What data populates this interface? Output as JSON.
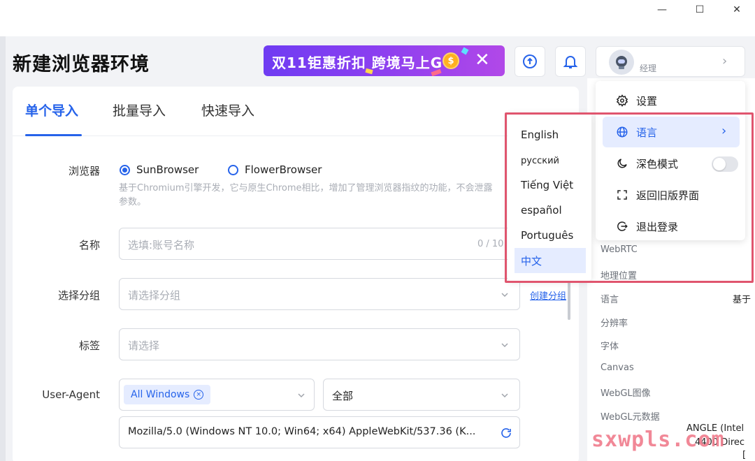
{
  "window": {
    "minimize": "—",
    "maximize": "☐",
    "close": "✕"
  },
  "app_title": "新建浏览器环境",
  "banner": {
    "text": "双11钜惠折扣 跨境马上G",
    "coin": "$",
    "close": "✕"
  },
  "user": {
    "name": "经理",
    "arrow": "›"
  },
  "tabs": [
    {
      "label": "单个导入",
      "active": true
    },
    {
      "label": "批量导入",
      "active": false
    },
    {
      "label": "快速导入",
      "active": false
    }
  ],
  "form": {
    "browser": {
      "label": "浏览器",
      "option1": "SunBrowser",
      "option2": "FlowerBrowser",
      "hint_line1": "基于Chromium引擎开发，它与原生Chrome相比，增加了管理浏览器指纹的功能，不会泄露",
      "hint_line2": "参数。"
    },
    "name": {
      "label": "名称",
      "placeholder": "选填:账号名称",
      "counter": "0 / 10"
    },
    "group": {
      "label": "选择分组",
      "placeholder": "请选择分组",
      "create_link": "创建分组"
    },
    "tags": {
      "label": "标签",
      "placeholder": "请选择"
    },
    "useragent": {
      "label": "User-Agent",
      "tag": "All Windows",
      "tag_close": "×",
      "version": "全部",
      "value": "Mozilla/5.0 (Windows NT 10.0; Win64; x64) AppleWebKit/537.36 (K..."
    }
  },
  "right_panel": {
    "items": [
      "WebRTC",
      "地理位置",
      "语言",
      "分辨率",
      "字体",
      "Canvas",
      "WebGL图像",
      "WebGL元数据"
    ],
    "lang_value": "基于",
    "webgl_meta_value1": "ANGLE (Intel",
    "webgl_meta_value2": "4400 Direc",
    "webgl_meta_value3": "["
  },
  "user_menu": {
    "items": [
      {
        "label": "设置",
        "icon": "gear-icon"
      },
      {
        "label": "语言",
        "icon": "globe-icon",
        "arrow": "›",
        "highlighted": true
      },
      {
        "label": "深色模式",
        "icon": "moon-icon",
        "toggle": false
      },
      {
        "label": "返回旧版界面",
        "icon": "switch-icon"
      },
      {
        "label": "退出登录",
        "icon": "logout-icon"
      }
    ]
  },
  "languages": [
    {
      "label": "English",
      "selected": false
    },
    {
      "label": "русский",
      "selected": false
    },
    {
      "label": "Tiếng Việt",
      "selected": false
    },
    {
      "label": "español",
      "selected": false
    },
    {
      "label": "Português",
      "selected": false
    },
    {
      "label": "中文",
      "selected": true
    }
  ],
  "watermark": "sxwpls.com",
  "colors": {
    "accent": "#2663ea",
    "highlight_box": "#e0556e",
    "banner": "#8a3ff0"
  }
}
